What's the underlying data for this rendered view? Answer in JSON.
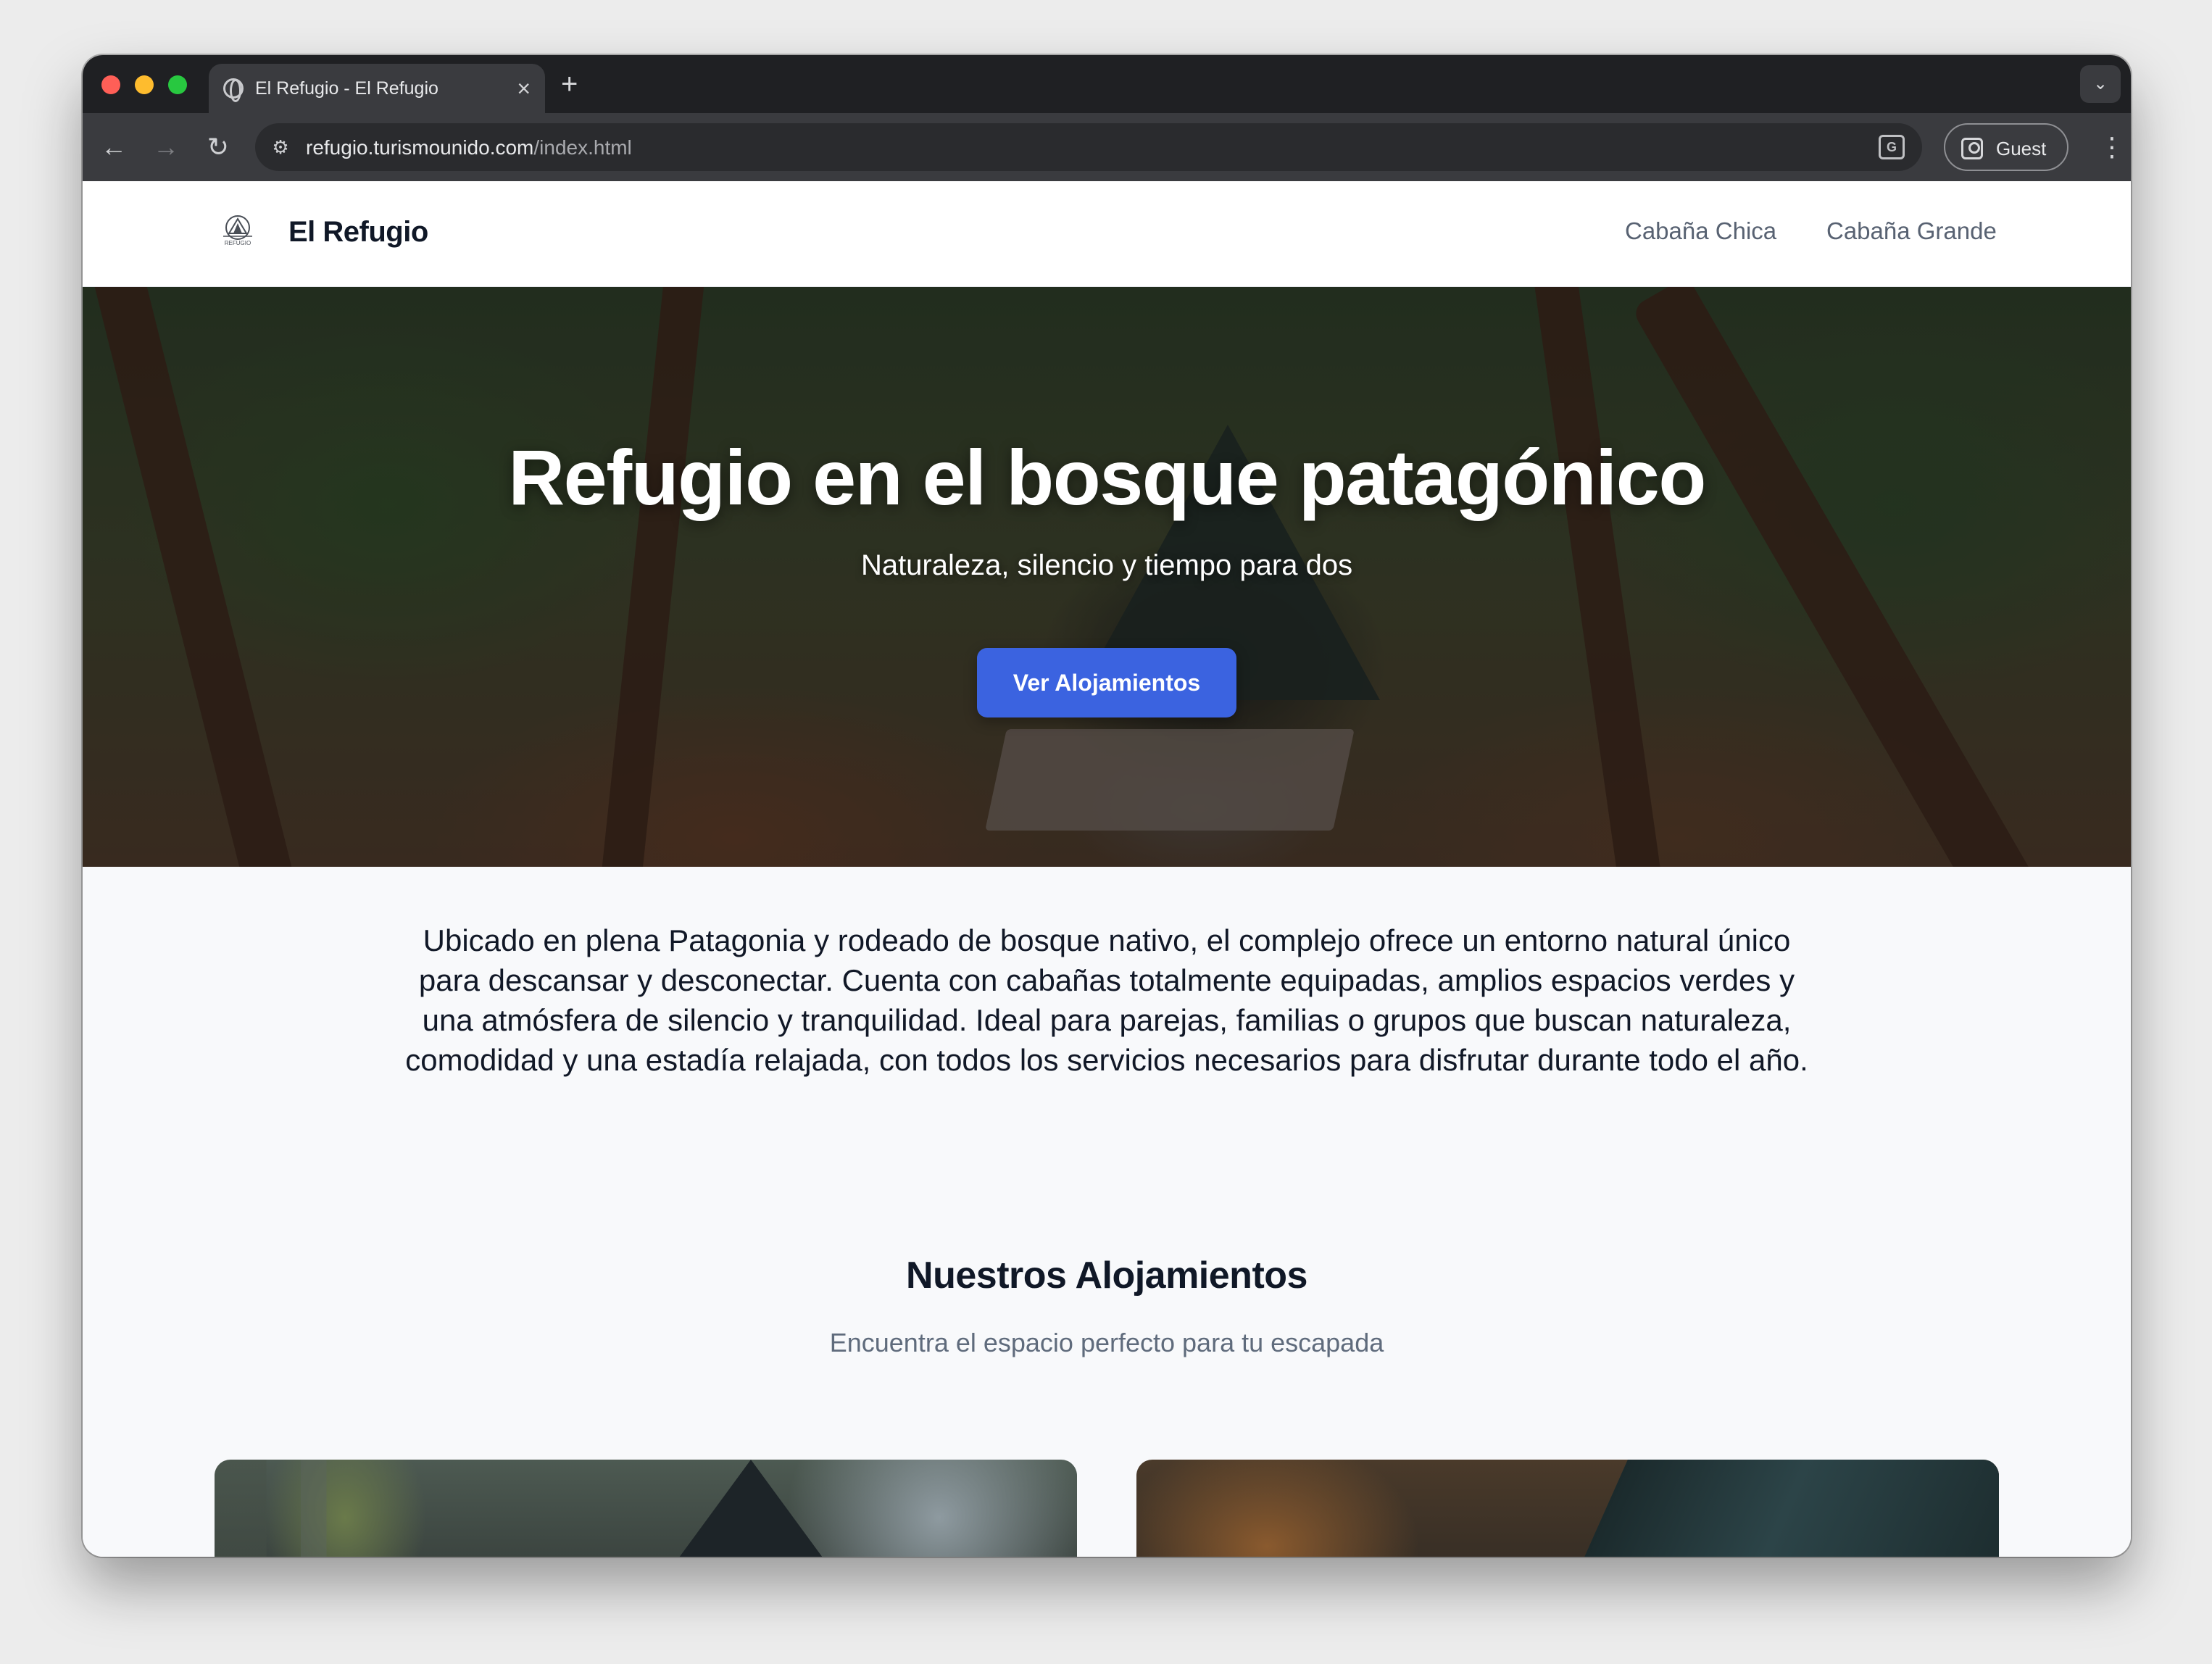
{
  "browser": {
    "tab_title": "El Refugio - El Refugio",
    "url_host": "refugio.turismounido.com",
    "url_path": "/index.html",
    "profile_label": "Guest"
  },
  "header": {
    "brand": "El Refugio",
    "logo_text": "REFUGIO",
    "nav": [
      "Cabaña Chica",
      "Cabaña Grande"
    ]
  },
  "hero": {
    "title": "Refugio en el bosque patagónico",
    "subtitle": "Naturaleza, silencio y tiempo para dos",
    "cta_label": "Ver Alojamientos"
  },
  "intro": {
    "text": "Ubicado en plena Patagonia y rodeado de bosque nativo, el complejo ofrece un entorno natural único para descansar y desconectar. Cuenta con cabañas totalmente equipadas, amplios espacios verdes y una atmósfera de silencio y tranquilidad. Ideal para parejas, familias o grupos que buscan naturaleza, comodidad y una estadía relajada, con todos los servicios necesarios para disfrutar durante todo el año."
  },
  "accommodations": {
    "title": "Nuestros Alojamientos",
    "subtitle": "Encuentra el espacio perfecto para tu escapada"
  },
  "colors": {
    "accent": "#3b63e0",
    "whatsapp": "#25d366",
    "heading": "#101827",
    "muted": "#5f6b7c"
  },
  "icons": [
    "globe-icon",
    "close-icon",
    "plus-icon",
    "chevron-down-icon",
    "back-arrow-icon",
    "forward-arrow-icon",
    "reload-icon",
    "site-info-icon",
    "translate-icon",
    "profile-icon",
    "kebab-menu-icon",
    "whatsapp-icon"
  ]
}
